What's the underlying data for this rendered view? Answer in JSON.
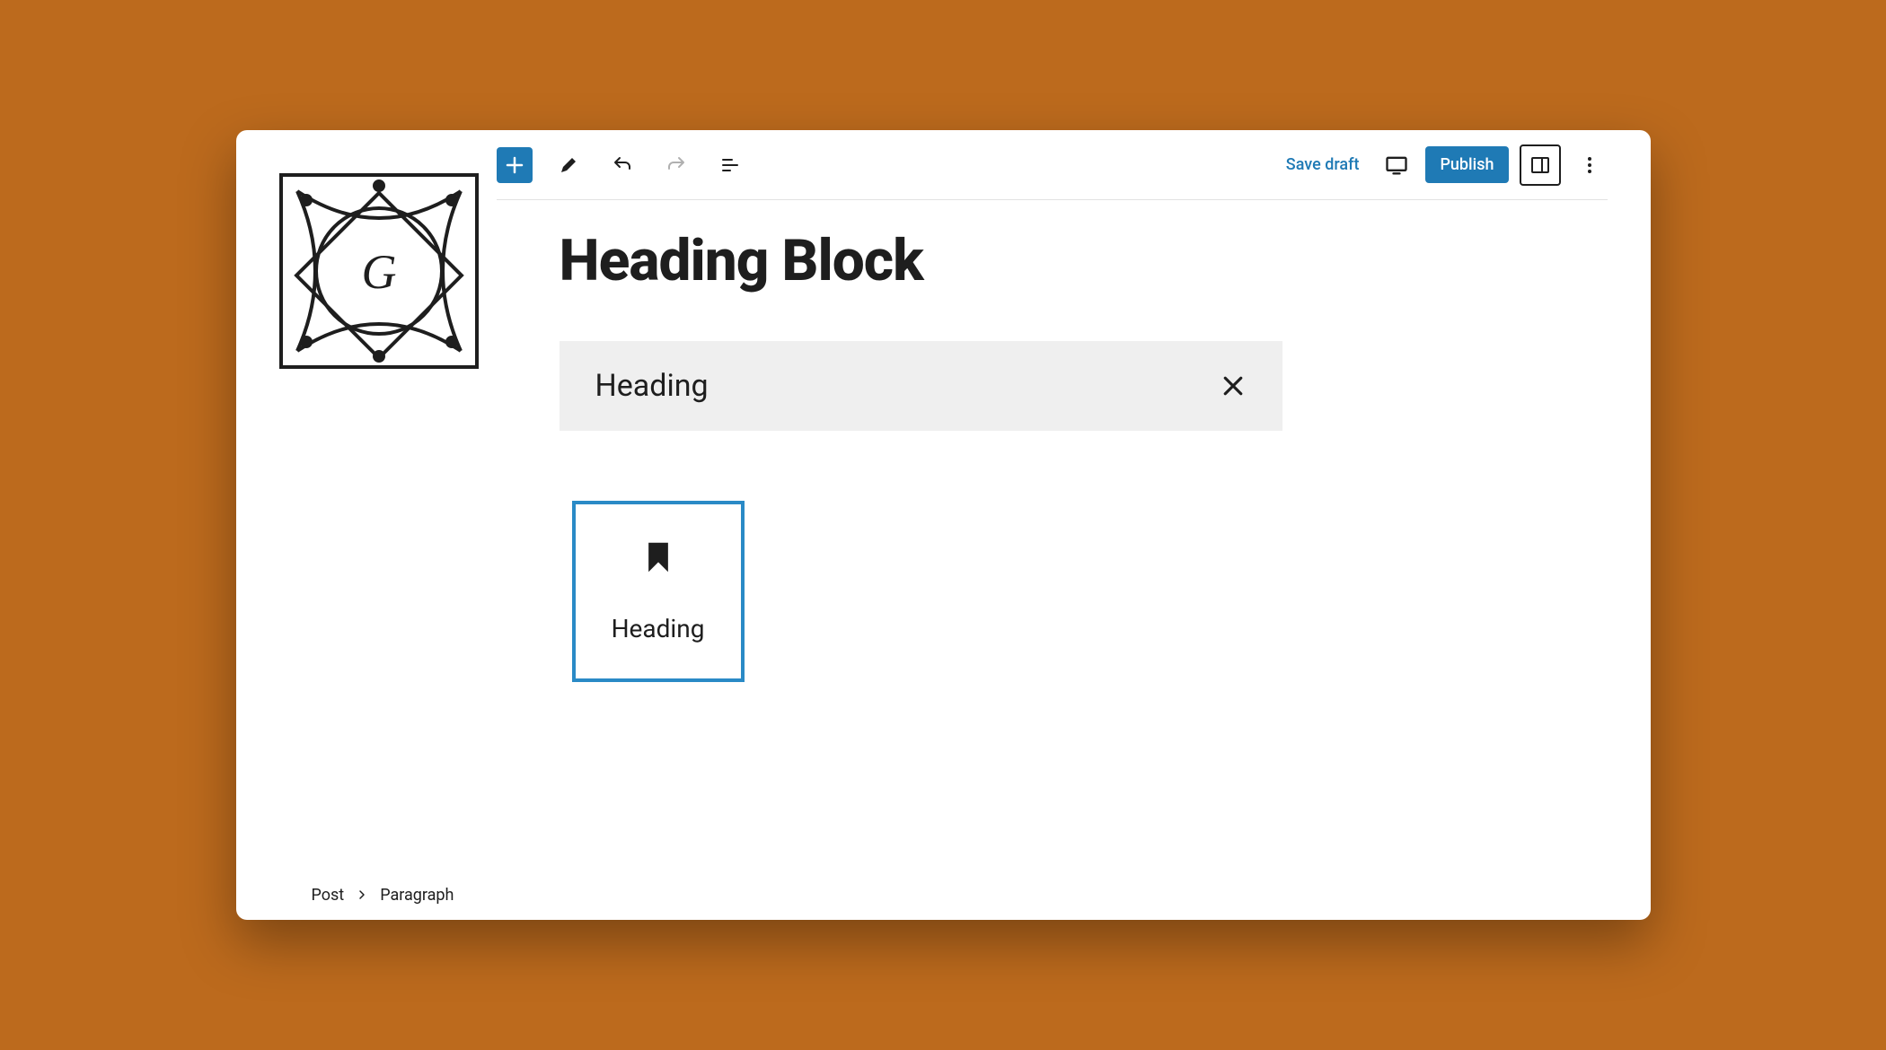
{
  "toolbar": {
    "save_draft_label": "Save draft",
    "publish_label": "Publish"
  },
  "editor": {
    "title": "Heading Block",
    "search_value": "Heading",
    "block_name": "Heading"
  },
  "breadcrumb": {
    "root": "Post",
    "current": "Paragraph"
  }
}
